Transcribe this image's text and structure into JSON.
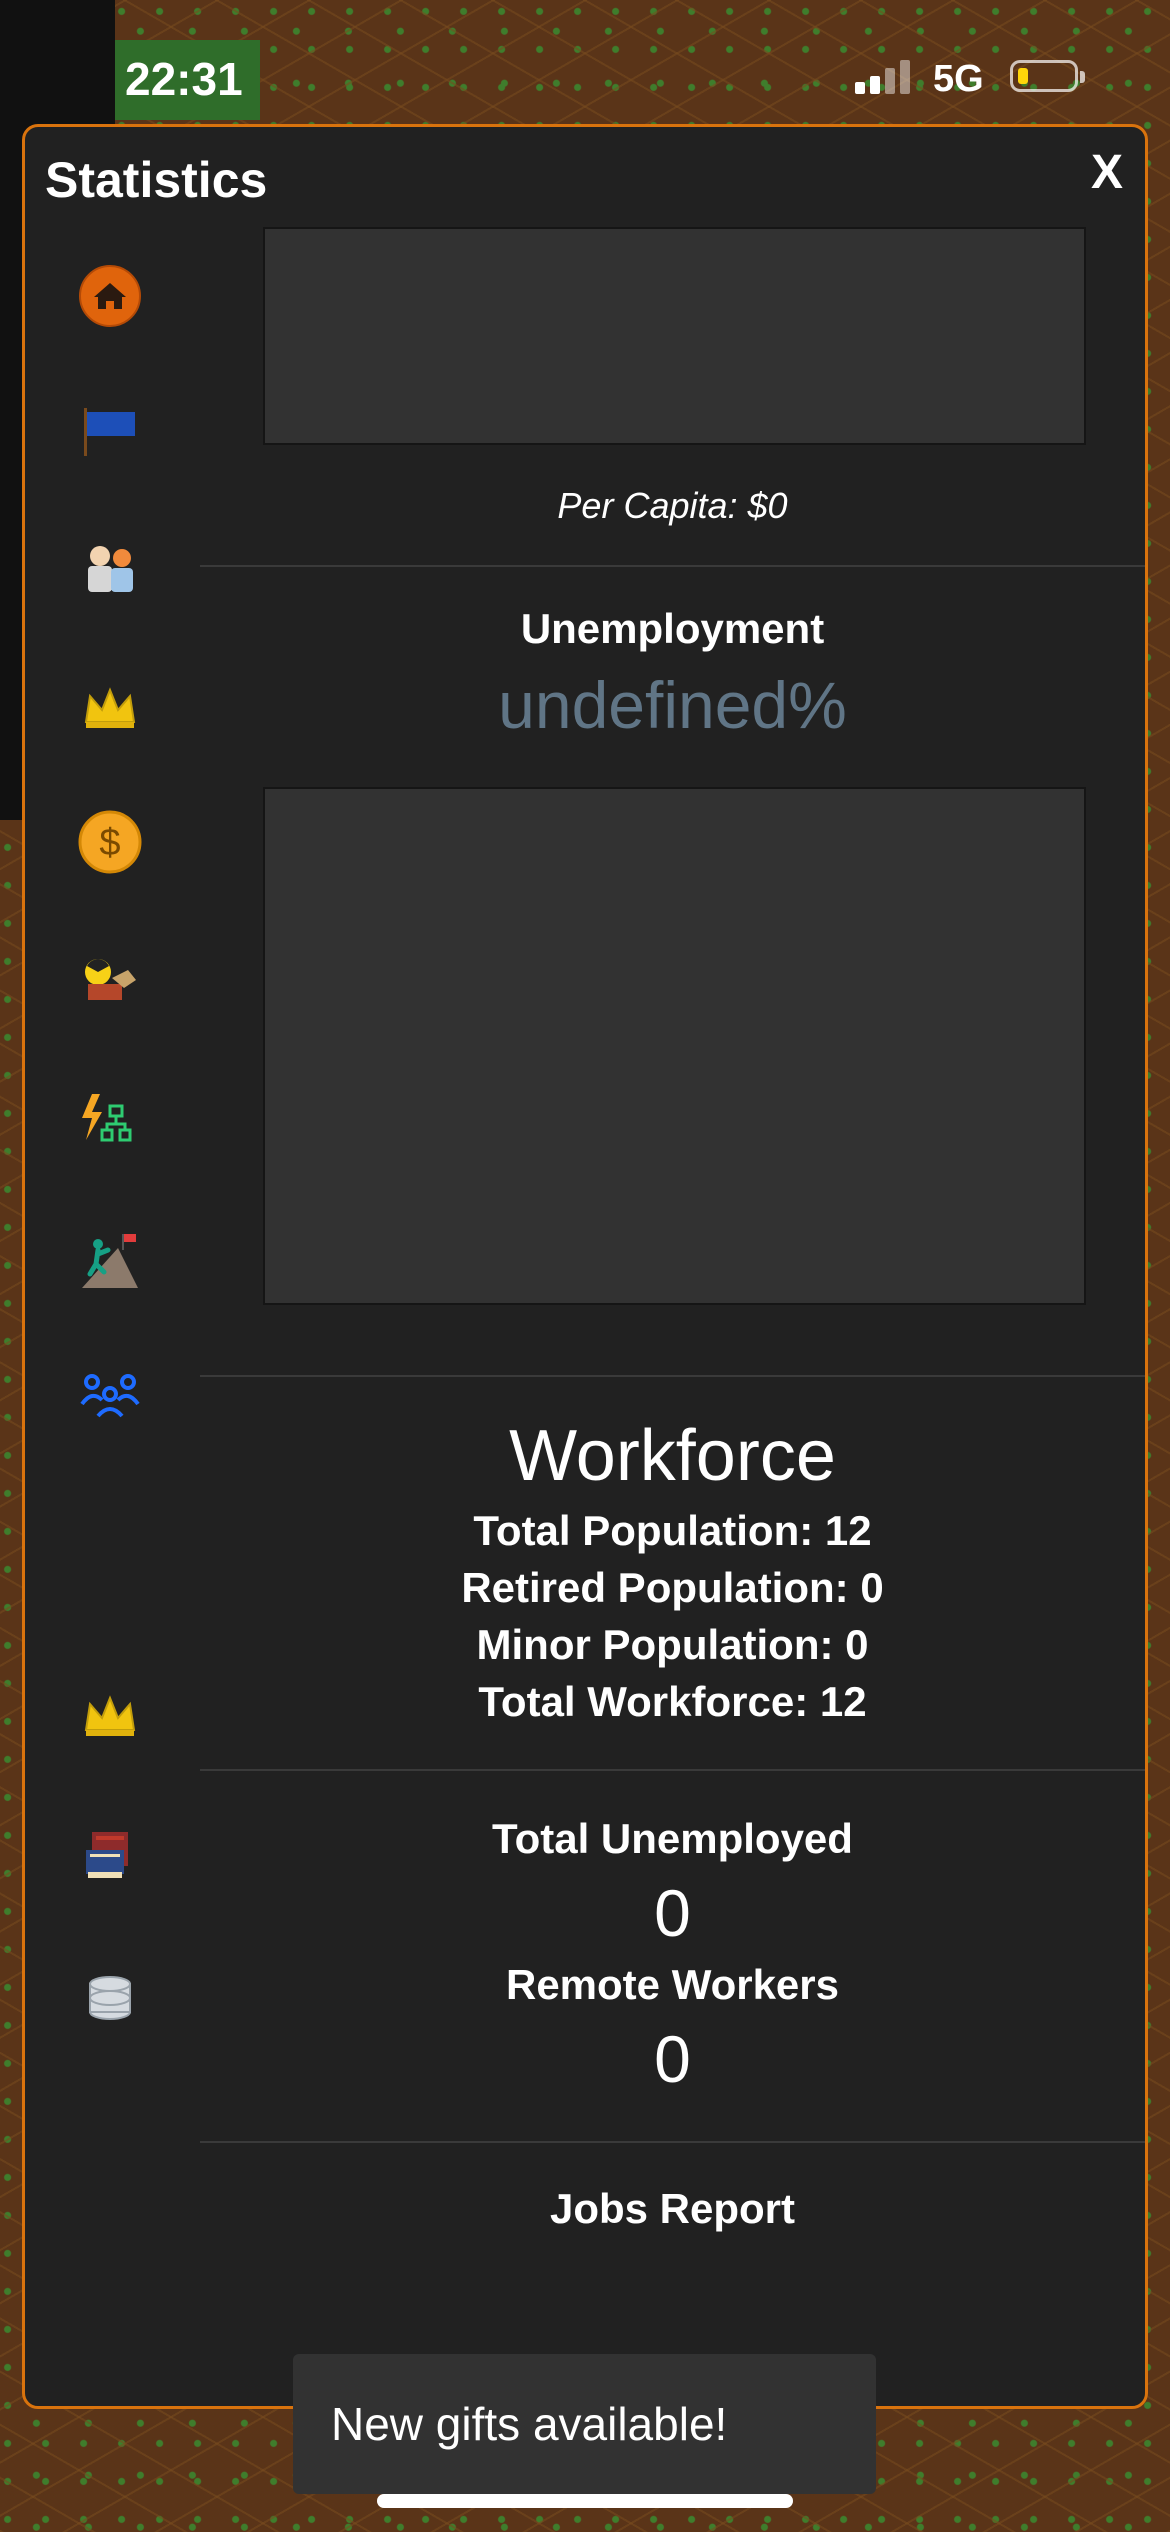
{
  "status_bar": {
    "time": "22:31",
    "network": "5G",
    "battery_color": "#ffd60a"
  },
  "panel": {
    "title": "Statistics",
    "close_label": "X",
    "accent_color": "#d9730d"
  },
  "sidebar": {
    "items": [
      {
        "icon": "home-icon"
      },
      {
        "icon": "flag-icon"
      },
      {
        "icon": "citizens-icon"
      },
      {
        "icon": "crown-icon"
      },
      {
        "icon": "dollar-coin-icon"
      },
      {
        "icon": "resources-icon"
      },
      {
        "icon": "power-network-icon"
      },
      {
        "icon": "climber-icon"
      },
      {
        "icon": "people-group-icon"
      },
      {
        "icon": "crown-icon"
      },
      {
        "icon": "books-icon"
      },
      {
        "icon": "data-stack-icon"
      }
    ]
  },
  "income": {
    "per_capita": "Per Capita: $0"
  },
  "unemployment": {
    "title": "Unemployment",
    "value": "undefined%"
  },
  "workforce": {
    "title": "Workforce",
    "total_population": "Total Population: 12",
    "retired_population": "Retired Population: 0",
    "minor_population": "Minor Population: 0",
    "total_workforce": "Total Workforce: 12"
  },
  "unemployed": {
    "total_label": "Total Unemployed",
    "total_value": "0",
    "remote_label": "Remote Workers",
    "remote_value": "0"
  },
  "jobs_report": {
    "title": "Jobs Report"
  },
  "toast": {
    "message": "New gifts available!"
  }
}
